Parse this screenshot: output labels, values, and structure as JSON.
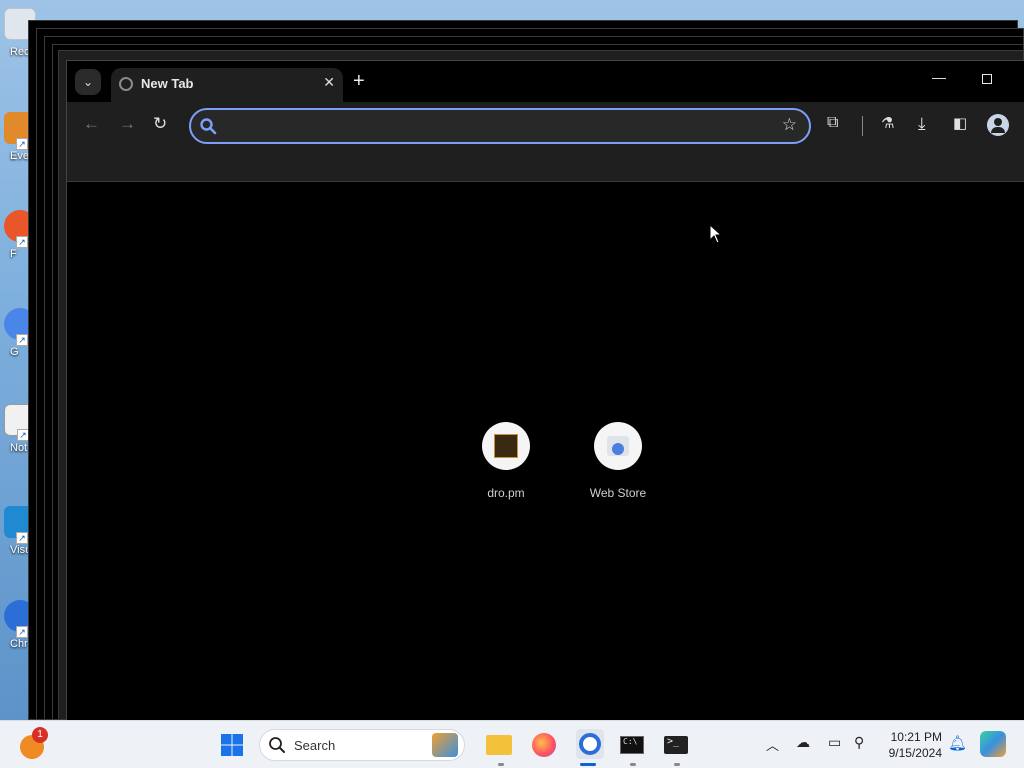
{
  "desktop": {
    "icons": [
      {
        "label": "Rec"
      },
      {
        "label": "Eve"
      },
      {
        "label": "F"
      },
      {
        "label": "G"
      },
      {
        "label": "Not"
      },
      {
        "label": "Visu"
      },
      {
        "label": "Chr"
      }
    ]
  },
  "browser": {
    "tab_title": "New Tab",
    "omnibox_value": "",
    "omnibox_placeholder": "",
    "shortcuts": [
      {
        "label": "dro.pm",
        "icon": "dro-pm-favicon"
      },
      {
        "label": "Web Store",
        "icon": "web-store-icon"
      }
    ]
  },
  "taskbar": {
    "search_label": "Search",
    "notification_badge": "1",
    "time": "10:21 PM",
    "date": "9/15/2024"
  },
  "colors": {
    "omnibox_border": "#7ca0f7",
    "browser_bg": "#000000",
    "toolbar_bg": "#1f1f1f",
    "taskbar_bg": "#eef1f6",
    "accent": "#0a64d6"
  }
}
